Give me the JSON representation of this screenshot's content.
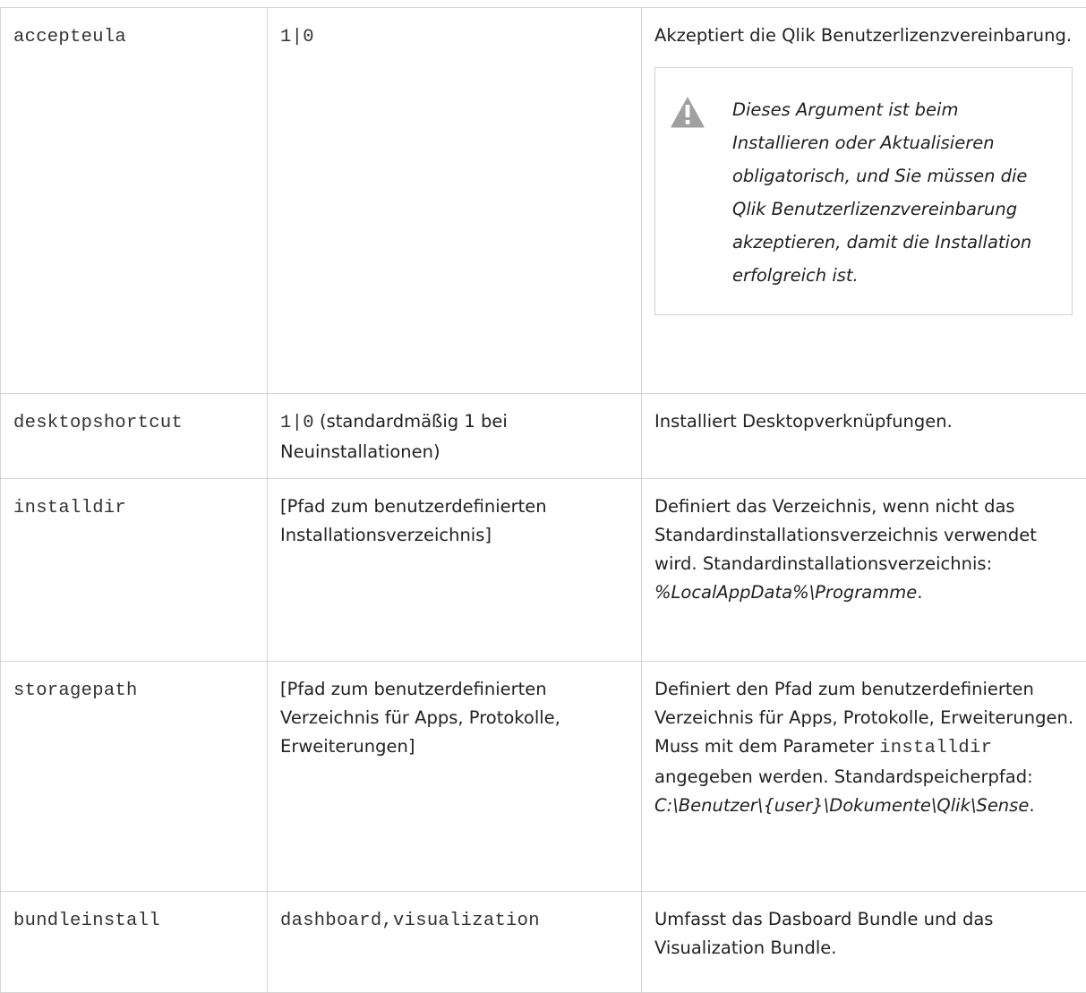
{
  "rows": [
    {
      "parameter": "accepteula",
      "value": "1|0",
      "description": "Akzeptiert die Qlik Benutzerlizenzvereinbarung.",
      "note": {
        "icon": "warning-icon",
        "text": "Dieses Argument ist beim Installieren oder Aktualisieren obligatorisch, und Sie müssen die Qlik Benutzerlizenzvereinbarung akzeptieren, damit die Installation erfolgreich ist."
      }
    },
    {
      "parameter": "desktopshortcut",
      "value_code": "1|0",
      "value_text": " (standardmäßig 1 bei Neuinstallationen)",
      "description": "Installiert Desktopverknüpfungen."
    },
    {
      "parameter": "installdir",
      "value": "[Pfad zum benutzerdefinierten Installationsverzeichnis]",
      "description_text": "Definiert das Verzeichnis, wenn nicht das Standardinstallationsverzeichnis verwendet wird. Standardinstallationsverzeichnis: ",
      "description_path": "%LocalAppData%\\Programme",
      "description_end": "."
    },
    {
      "parameter": "storagepath",
      "value": "[Pfad zum benutzerdefinierten Verzeichnis für Apps, Protokolle, Erweiterungen]",
      "description_text1": "Definiert den Pfad zum benutzerdefinierten Verzeichnis für Apps, Protokolle, Erweiterungen. Muss mit dem Parameter ",
      "description_code": "installdir",
      "description_text2": " angegeben werden. Standardspeicherpfad: ",
      "description_path": "C:\\Benutzer\\{user}\\Dokumente\\Qlik\\Sense",
      "description_end": "."
    },
    {
      "parameter": "bundleinstall",
      "value": "dashboard,visualization",
      "description": "Umfasst das Dasboard Bundle und das Visualization Bundle."
    }
  ],
  "colors": {
    "border": "#d4d4d4",
    "icon": "#a0a0a0",
    "text": "#222222"
  }
}
